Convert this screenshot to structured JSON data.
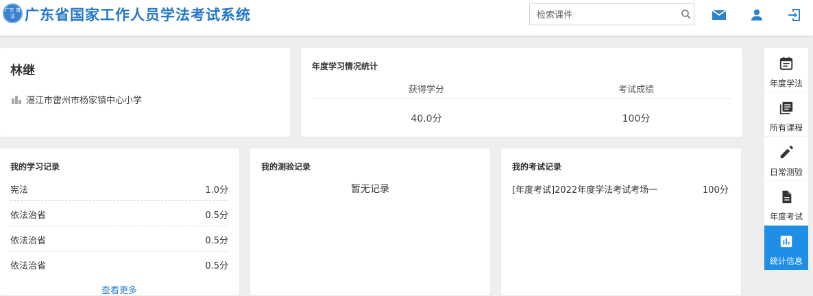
{
  "header": {
    "logo_text": "广东 普法",
    "title": "广东省国家工作人员学法考试系统",
    "search_placeholder": "检索课件",
    "search_value": "",
    "icons": [
      "mail-icon",
      "user-icon",
      "logout-icon"
    ]
  },
  "profile": {
    "name": "林继",
    "organization": "湛江市雷州市杨家镇中心小学"
  },
  "stats": {
    "title": "年度学习情况统计",
    "credits_label": "获得学分",
    "credits_value": "40.0分",
    "score_label": "考试成绩",
    "score_value": "100分"
  },
  "study": {
    "title": "我的学习记录",
    "rows": [
      {
        "name": "宪法",
        "points": "1.0分"
      },
      {
        "name": "依法治省",
        "points": "0.5分"
      },
      {
        "name": "依法治省",
        "points": "0.5分"
      },
      {
        "name": "依法治省",
        "points": "0.5分"
      }
    ],
    "more": "查看更多"
  },
  "quiz": {
    "title": "我的测验记录",
    "empty": "暂无记录"
  },
  "exam": {
    "title": "我的考试记录",
    "records": [
      {
        "name": "[年度考试]2022年度学法考试考场一",
        "score": "100分"
      }
    ]
  },
  "nav": {
    "items": [
      {
        "label": "年度学法",
        "icon": "calendar-icon"
      },
      {
        "label": "所有课程",
        "icon": "library-icon"
      },
      {
        "label": "日常测验",
        "icon": "pencil-icon"
      },
      {
        "label": "年度考试",
        "icon": "document-icon"
      },
      {
        "label": "统计信息",
        "icon": "chart-icon",
        "active": true
      }
    ]
  },
  "colors": {
    "brand": "#2176c7",
    "accent": "#1e8ee6",
    "link": "#2a82d0"
  }
}
